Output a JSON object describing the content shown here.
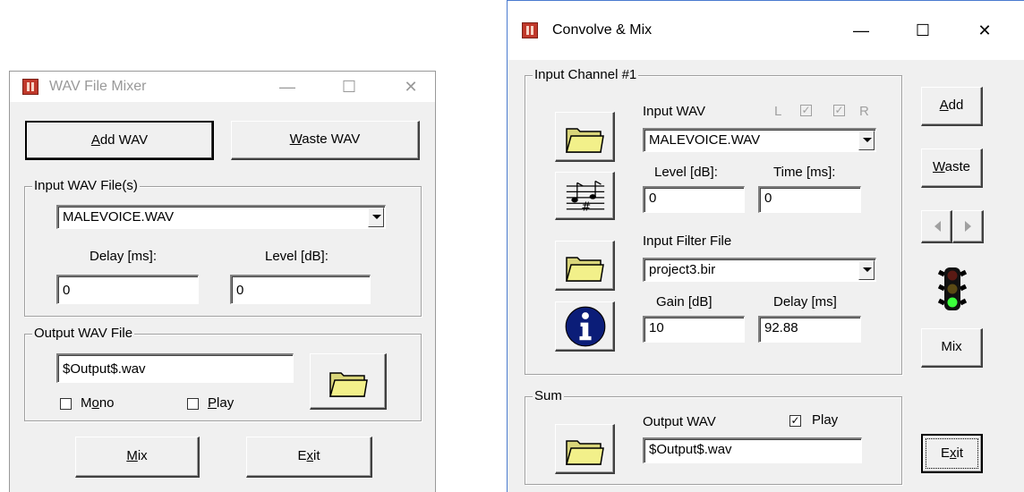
{
  "left_window": {
    "title": "WAV File Mixer",
    "minimize": "—",
    "maximize": "☐",
    "close": "✕",
    "add_wav": {
      "pre": "",
      "key": "A",
      "post": "dd WAV"
    },
    "waste_wav": {
      "pre": "",
      "key": "W",
      "post": "aste WAV"
    },
    "input_group": "Input WAV File(s)",
    "input_file": "MALEVOICE.WAV",
    "delay_label": "Delay [ms]:",
    "level_label": "Level [dB]:",
    "delay_value": "0",
    "level_value": "0",
    "output_group": "Output WAV File",
    "output_file": "$Output$.wav",
    "mono": {
      "pre": "M",
      "key": "o",
      "post": "no"
    },
    "play": {
      "pre": "",
      "key": "P",
      "post": "lay"
    },
    "mix": {
      "pre": "",
      "key": "M",
      "post": "ix"
    },
    "exit": {
      "pre": "E",
      "key": "x",
      "post": "it"
    }
  },
  "right_window": {
    "title": "Convolve & Mix",
    "minimize": "—",
    "maximize": "☐",
    "close": "✕",
    "channel_group": "Input Channel #1",
    "input_wav_label": "Input WAV",
    "ch_l": "L",
    "ch_r": "R",
    "input_wav": "MALEVOICE.WAV",
    "level_label": "Level [dB]:",
    "time_label": "Time [ms]:",
    "level_value": "0",
    "time_value": "0",
    "filter_label": "Input Filter File",
    "filter_file": "project3.bir",
    "gain_label": "Gain [dB]",
    "delay_label": "Delay [ms]",
    "gain_value": "10",
    "delay_value": "92.88",
    "sum_group": "Sum",
    "output_label": "Output WAV",
    "play_label": "Play",
    "output_file": "$Output$.wav",
    "add": {
      "pre": "",
      "key": "A",
      "post": "dd"
    },
    "waste": {
      "pre": "",
      "key": "W",
      "post": "aste"
    },
    "mix": "Mix",
    "exit": {
      "pre": "E",
      "key": "x",
      "post": "it"
    }
  },
  "colors": {
    "folder": "#f2f08a",
    "info": "#0b1d78",
    "traffic_green": "#3cff3c"
  }
}
